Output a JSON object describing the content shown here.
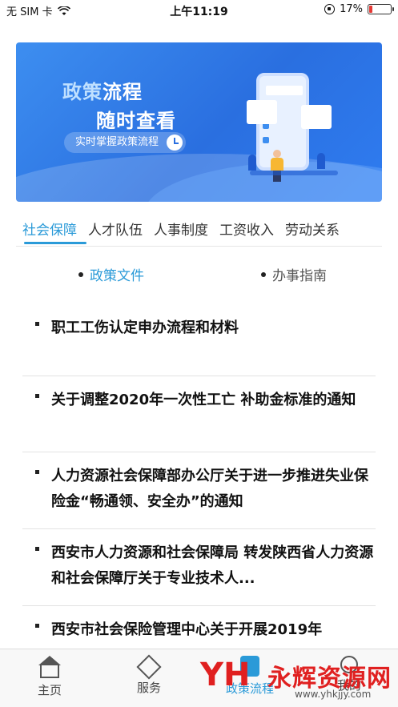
{
  "status_bar": {
    "carrier": "无 SIM 卡",
    "time": "上午11:19",
    "battery": "17%",
    "battery_level": 0.17,
    "battery_color": "#e53935"
  },
  "banner": {
    "title_line1_highlight": "政策",
    "title_line1_rest": "流程",
    "title_line2": "随时查看",
    "pill_text": "实时掌握政策流程",
    "pill_icon": "clock-icon"
  },
  "tabs": [
    {
      "label": "社会保障",
      "active": true
    },
    {
      "label": "人才队伍",
      "active": false
    },
    {
      "label": "人事制度",
      "active": false
    },
    {
      "label": "工资收入",
      "active": false
    },
    {
      "label": "劳动关系",
      "active": false
    }
  ],
  "subtabs": [
    {
      "label": "政策文件",
      "active": true
    },
    {
      "label": "办事指南",
      "active": false
    }
  ],
  "items": [
    {
      "title": "职工工伤认定申办流程和材料"
    },
    {
      "title": "关于调整2020年一次性工亡 补助金标准的通知"
    },
    {
      "title": "人力资源社会保障部办公厅关于进一步推进失业保险金“畅通领、安全办”的通知"
    },
    {
      "title": "西安市人力资源和社会保障局 转发陕西省人力资源和社会保障厅关于专业技术人..."
    },
    {
      "title": "西安市社会保险管理中心关于开展2019年"
    }
  ],
  "bottom_nav": [
    {
      "label": "主页",
      "icon": "home-icon"
    },
    {
      "label": "服务",
      "icon": "service-icon"
    },
    {
      "label": "政策流程",
      "icon": "process-icon"
    },
    {
      "label": "我的",
      "icon": "profile-icon"
    }
  ],
  "watermark": {
    "logo": "YH",
    "name": "永辉资源网",
    "url": "www.yhkjjy.com"
  },
  "colors": {
    "accent": "#2a9ad8",
    "banner_blue": "#2a6fe0"
  }
}
